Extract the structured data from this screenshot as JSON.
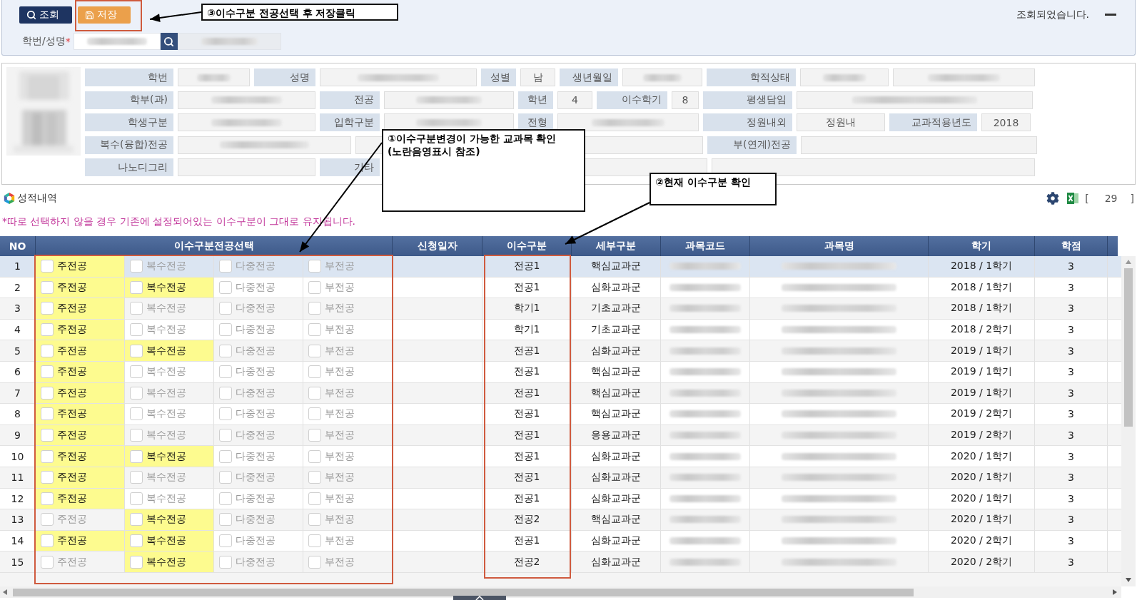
{
  "toolbar": {
    "buttons": [
      {
        "kind": "search",
        "label": "조회"
      },
      {
        "kind": "save",
        "label": "저장"
      }
    ],
    "message": "조회되었습니다."
  },
  "search": {
    "label": "학번/성명",
    "required": "*"
  },
  "student_info": {
    "lines": [
      [
        {
          "label": "학번",
          "values": [
            {
              "kind": "blurred"
            }
          ]
        },
        {
          "label": "성명",
          "values": [
            {
              "kind": "blurred"
            }
          ]
        },
        {
          "label": "성별",
          "values": [
            {
              "kind": "value",
              "text": "남"
            }
          ]
        },
        {
          "label": "생년월일",
          "values": [
            {
              "kind": "blurred"
            }
          ]
        },
        {
          "label": "학적상태",
          "values": [
            {
              "kind": "blurred"
            },
            {
              "kind": "blurred"
            }
          ]
        }
      ],
      [
        {
          "label": "학부(과)",
          "values": [
            {
              "kind": "blurred"
            }
          ]
        },
        {
          "label": "전공",
          "values": [
            {
              "kind": "blurred"
            }
          ]
        },
        {
          "label": "학년",
          "values": [
            {
              "kind": "value",
              "text": "4"
            }
          ]
        },
        {
          "label": "이수학기",
          "values": [
            {
              "kind": "value",
              "text": "8"
            }
          ]
        },
        {
          "label": "평생담임",
          "values": [
            {
              "kind": "blurred"
            }
          ]
        }
      ],
      [
        {
          "label": "학생구분",
          "values": [
            {
              "kind": "blurred"
            }
          ]
        },
        {
          "label": "입학구분",
          "values": [
            {
              "kind": "blurred"
            }
          ]
        },
        {
          "label": "전형",
          "values": [
            {
              "kind": "blurred"
            }
          ]
        },
        {
          "label": "정원내외",
          "values": [
            {
              "kind": "value",
              "text": "정원내"
            }
          ]
        },
        {
          "label": "교과적용년도",
          "values": [
            {
              "kind": "value",
              "text": "2018"
            }
          ]
        }
      ],
      [
        {
          "label": "복수(융합)전공",
          "values": [
            {
              "kind": "blurred"
            },
            {
              "kind": "empty"
            },
            {
              "kind": "empty"
            }
          ]
        },
        {
          "label": "부(연계)전공",
          "values": [
            {
              "kind": "empty"
            }
          ]
        }
      ],
      [
        {
          "label": "나노디그리",
          "values": [
            {
              "kind": "empty"
            }
          ]
        },
        {
          "label": "기타",
          "values": [
            {
              "kind": "empty"
            },
            {
              "kind": "empty"
            }
          ]
        }
      ]
    ]
  },
  "section": {
    "title": "성적내역",
    "count_open": "[",
    "count": "29",
    "count_close": "]",
    "note": "*따로 선택하지 않을 경우 기존에 설정되어있는 이수구분이 그대로 유지됩니다."
  },
  "table": {
    "columns": [
      {
        "label": "NO",
        "kind": "no"
      },
      {
        "label": "이수구분전공선택",
        "kind": "options"
      },
      {
        "label": "신청일자",
        "kind": "blank"
      },
      {
        "label": "이수구분",
        "kind": "text"
      },
      {
        "label": "세부구분",
        "kind": "text"
      },
      {
        "label": "과목코드",
        "kind": "redacted"
      },
      {
        "label": "과목명",
        "kind": "redacted"
      },
      {
        "label": "학기",
        "kind": "text"
      },
      {
        "label": "학점",
        "kind": "text"
      }
    ],
    "rows": [
      {
        "selected": true,
        "cells": [
          "1",
          {
            "options": [
              {
                "label": "주전공",
                "available": true,
                "checked": false
              },
              {
                "label": "복수전공",
                "available": false,
                "checked": false
              },
              {
                "label": "다중전공",
                "available": false,
                "checked": false
              },
              {
                "label": "부전공",
                "available": false,
                "checked": false
              }
            ]
          },
          "",
          "전공1",
          "핵심교과군",
          {
            "redacted": true
          },
          {
            "redacted": true
          },
          "2018 / 1학기",
          "3"
        ]
      },
      {
        "selected": false,
        "cells": [
          "2",
          {
            "options": [
              {
                "label": "주전공",
                "available": true,
                "checked": false
              },
              {
                "label": "복수전공",
                "available": true,
                "checked": false
              },
              {
                "label": "다중전공",
                "available": false,
                "checked": false
              },
              {
                "label": "부전공",
                "available": false,
                "checked": false
              }
            ]
          },
          "",
          "전공1",
          "심화교과군",
          {
            "redacted": true
          },
          {
            "redacted": true
          },
          "2018 / 1학기",
          "3"
        ]
      },
      {
        "selected": false,
        "cells": [
          "3",
          {
            "options": [
              {
                "label": "주전공",
                "available": true,
                "checked": false
              },
              {
                "label": "복수전공",
                "available": false,
                "checked": false
              },
              {
                "label": "다중전공",
                "available": false,
                "checked": false
              },
              {
                "label": "부전공",
                "available": false,
                "checked": false
              }
            ]
          },
          "",
          "학기1",
          "기초교과군",
          {
            "redacted": true
          },
          {
            "redacted": true
          },
          "2018 / 1학기",
          "3"
        ]
      },
      {
        "selected": false,
        "cells": [
          "4",
          {
            "options": [
              {
                "label": "주전공",
                "available": true,
                "checked": false
              },
              {
                "label": "복수전공",
                "available": false,
                "checked": false
              },
              {
                "label": "다중전공",
                "available": false,
                "checked": false
              },
              {
                "label": "부전공",
                "available": false,
                "checked": false
              }
            ]
          },
          "",
          "학기1",
          "기초교과군",
          {
            "redacted": true
          },
          {
            "redacted": true
          },
          "2018 / 2학기",
          "3"
        ]
      },
      {
        "selected": false,
        "cells": [
          "5",
          {
            "options": [
              {
                "label": "주전공",
                "available": true,
                "checked": false
              },
              {
                "label": "복수전공",
                "available": true,
                "checked": false
              },
              {
                "label": "다중전공",
                "available": false,
                "checked": false
              },
              {
                "label": "부전공",
                "available": false,
                "checked": false
              }
            ]
          },
          "",
          "전공1",
          "심화교과군",
          {
            "redacted": true
          },
          {
            "redacted": true
          },
          "2019 / 1학기",
          "3"
        ]
      },
      {
        "selected": false,
        "cells": [
          "6",
          {
            "options": [
              {
                "label": "주전공",
                "available": true,
                "checked": false
              },
              {
                "label": "복수전공",
                "available": false,
                "checked": false
              },
              {
                "label": "다중전공",
                "available": false,
                "checked": false
              },
              {
                "label": "부전공",
                "available": false,
                "checked": false
              }
            ]
          },
          "",
          "전공1",
          "핵심교과군",
          {
            "redacted": true
          },
          {
            "redacted": true
          },
          "2019 / 1학기",
          "3"
        ]
      },
      {
        "selected": false,
        "cells": [
          "7",
          {
            "options": [
              {
                "label": "주전공",
                "available": true,
                "checked": false
              },
              {
                "label": "복수전공",
                "available": false,
                "checked": false
              },
              {
                "label": "다중전공",
                "available": false,
                "checked": false
              },
              {
                "label": "부전공",
                "available": false,
                "checked": false
              }
            ]
          },
          "",
          "전공1",
          "핵심교과군",
          {
            "redacted": true
          },
          {
            "redacted": true
          },
          "2019 / 1학기",
          "3"
        ]
      },
      {
        "selected": false,
        "cells": [
          "8",
          {
            "options": [
              {
                "label": "주전공",
                "available": true,
                "checked": false
              },
              {
                "label": "복수전공",
                "available": false,
                "checked": false
              },
              {
                "label": "다중전공",
                "available": false,
                "checked": false
              },
              {
                "label": "부전공",
                "available": false,
                "checked": false
              }
            ]
          },
          "",
          "전공1",
          "핵심교과군",
          {
            "redacted": true
          },
          {
            "redacted": true
          },
          "2019 / 2학기",
          "3"
        ]
      },
      {
        "selected": false,
        "cells": [
          "9",
          {
            "options": [
              {
                "label": "주전공",
                "available": true,
                "checked": false
              },
              {
                "label": "복수전공",
                "available": false,
                "checked": false
              },
              {
                "label": "다중전공",
                "available": false,
                "checked": false
              },
              {
                "label": "부전공",
                "available": false,
                "checked": false
              }
            ]
          },
          "",
          "전공1",
          "응용교과군",
          {
            "redacted": true
          },
          {
            "redacted": true
          },
          "2019 / 2학기",
          "3"
        ]
      },
      {
        "selected": false,
        "cells": [
          "10",
          {
            "options": [
              {
                "label": "주전공",
                "available": true,
                "checked": false
              },
              {
                "label": "복수전공",
                "available": true,
                "checked": false
              },
              {
                "label": "다중전공",
                "available": false,
                "checked": false
              },
              {
                "label": "부전공",
                "available": false,
                "checked": false
              }
            ]
          },
          "",
          "전공1",
          "심화교과군",
          {
            "redacted": true
          },
          {
            "redacted": true
          },
          "2020 / 1학기",
          "3"
        ]
      },
      {
        "selected": false,
        "cells": [
          "11",
          {
            "options": [
              {
                "label": "주전공",
                "available": true,
                "checked": false
              },
              {
                "label": "복수전공",
                "available": false,
                "checked": false
              },
              {
                "label": "다중전공",
                "available": false,
                "checked": false
              },
              {
                "label": "부전공",
                "available": false,
                "checked": false
              }
            ]
          },
          "",
          "전공1",
          "심화교과군",
          {
            "redacted": true
          },
          {
            "redacted": true
          },
          "2020 / 1학기",
          "3"
        ]
      },
      {
        "selected": false,
        "cells": [
          "12",
          {
            "options": [
              {
                "label": "주전공",
                "available": true,
                "checked": false
              },
              {
                "label": "복수전공",
                "available": false,
                "checked": false
              },
              {
                "label": "다중전공",
                "available": false,
                "checked": false
              },
              {
                "label": "부전공",
                "available": false,
                "checked": false
              }
            ]
          },
          "",
          "전공1",
          "심화교과군",
          {
            "redacted": true
          },
          {
            "redacted": true
          },
          "2020 / 1학기",
          "3"
        ]
      },
      {
        "selected": false,
        "cells": [
          "13",
          {
            "options": [
              {
                "label": "주전공",
                "available": false,
                "checked": false
              },
              {
                "label": "복수전공",
                "available": true,
                "checked": false
              },
              {
                "label": "다중전공",
                "available": false,
                "checked": false
              },
              {
                "label": "부전공",
                "available": false,
                "checked": false
              }
            ]
          },
          "",
          "전공2",
          "핵심교과군",
          {
            "redacted": true
          },
          {
            "redacted": true
          },
          "2020 / 1학기",
          "3"
        ]
      },
      {
        "selected": false,
        "cells": [
          "14",
          {
            "options": [
              {
                "label": "주전공",
                "available": true,
                "checked": false
              },
              {
                "label": "복수전공",
                "available": true,
                "checked": false
              },
              {
                "label": "다중전공",
                "available": false,
                "checked": false
              },
              {
                "label": "부전공",
                "available": false,
                "checked": false
              }
            ]
          },
          "",
          "전공1",
          "심화교과군",
          {
            "redacted": true
          },
          {
            "redacted": true
          },
          "2020 / 2학기",
          "3"
        ]
      },
      {
        "selected": false,
        "cells": [
          "15",
          {
            "options": [
              {
                "label": "주전공",
                "available": false,
                "checked": false
              },
              {
                "label": "복수전공",
                "available": true,
                "checked": false
              },
              {
                "label": "다중전공",
                "available": false,
                "checked": false
              },
              {
                "label": "부전공",
                "available": false,
                "checked": false
              }
            ]
          },
          "",
          "전공2",
          "심화교과군",
          {
            "redacted": true
          },
          {
            "redacted": true
          },
          "2020 / 2학기",
          "3"
        ]
      }
    ]
  },
  "annotations": [
    {
      "lines": [
        "③이수구분 전공선택 후 저장클릭"
      ],
      "framed": true
    },
    {
      "lines": [
        "①이수구분변경이 가능한 교과목 확인",
        "(노란음영표시 참조)"
      ],
      "framed": true
    },
    {
      "lines": [
        "②현재 이수구분 확인"
      ],
      "framed": true
    }
  ]
}
